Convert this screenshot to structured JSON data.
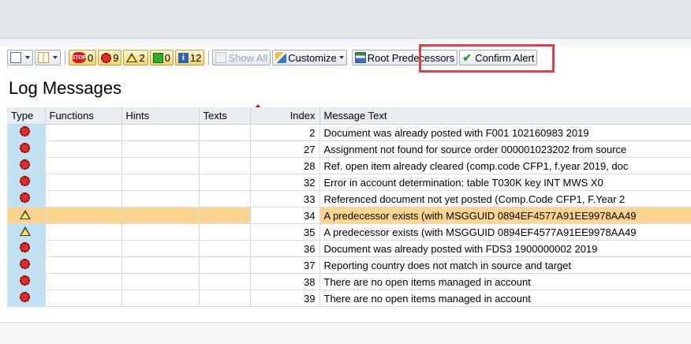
{
  "toolbar": {
    "counts": {
      "error": "9",
      "warning": "2",
      "success": "0",
      "info": "12",
      "stop": "0"
    },
    "show_all_label": "Show All",
    "customize_label": "Customize",
    "root_predecessors_label": "Root Predecessors",
    "confirm_alert_label": "Confirm Alert"
  },
  "title": "Log Messages",
  "columns": {
    "type": "Type",
    "functions": "Functions",
    "hints": "Hints",
    "texts": "Texts",
    "index": "Index",
    "message": "Message Text"
  },
  "rows": [
    {
      "index": "2",
      "text": "Document was already posted with F001 102160983 2019"
    },
    {
      "index": "27",
      "text": "Assignment not found for source order 000001023202 from source"
    },
    {
      "index": "28",
      "text": "Ref. open item already cleared (comp.code CFP1, f.year 2019, doc"
    },
    {
      "index": "32",
      "text": "Error in account determination: table T030K key INT MWS X0"
    },
    {
      "index": "33",
      "text": "Referenced document not yet posted (Comp.Code CFP1, F.Year 2"
    },
    {
      "index": "34",
      "text": "A predecessor exists (with MSGGUID 0894EF4577A91EE9978AA49"
    },
    {
      "index": "35",
      "text": "A predecessor exists (with MSGGUID 0894EF4577A91EE9978AA49"
    },
    {
      "index": "36",
      "text": "Document was already posted with FDS3 1900000002 2019"
    },
    {
      "index": "37",
      "text": "Reporting country does not match in source and target"
    },
    {
      "index": "38",
      "text": "There are no open items managed in account"
    },
    {
      "index": "39",
      "text": "There are no open items managed in account"
    }
  ],
  "colors": {
    "highlight_box": "#e0404a",
    "selected_row": "#fcd48e",
    "type_cell": "#bfe3f5"
  }
}
